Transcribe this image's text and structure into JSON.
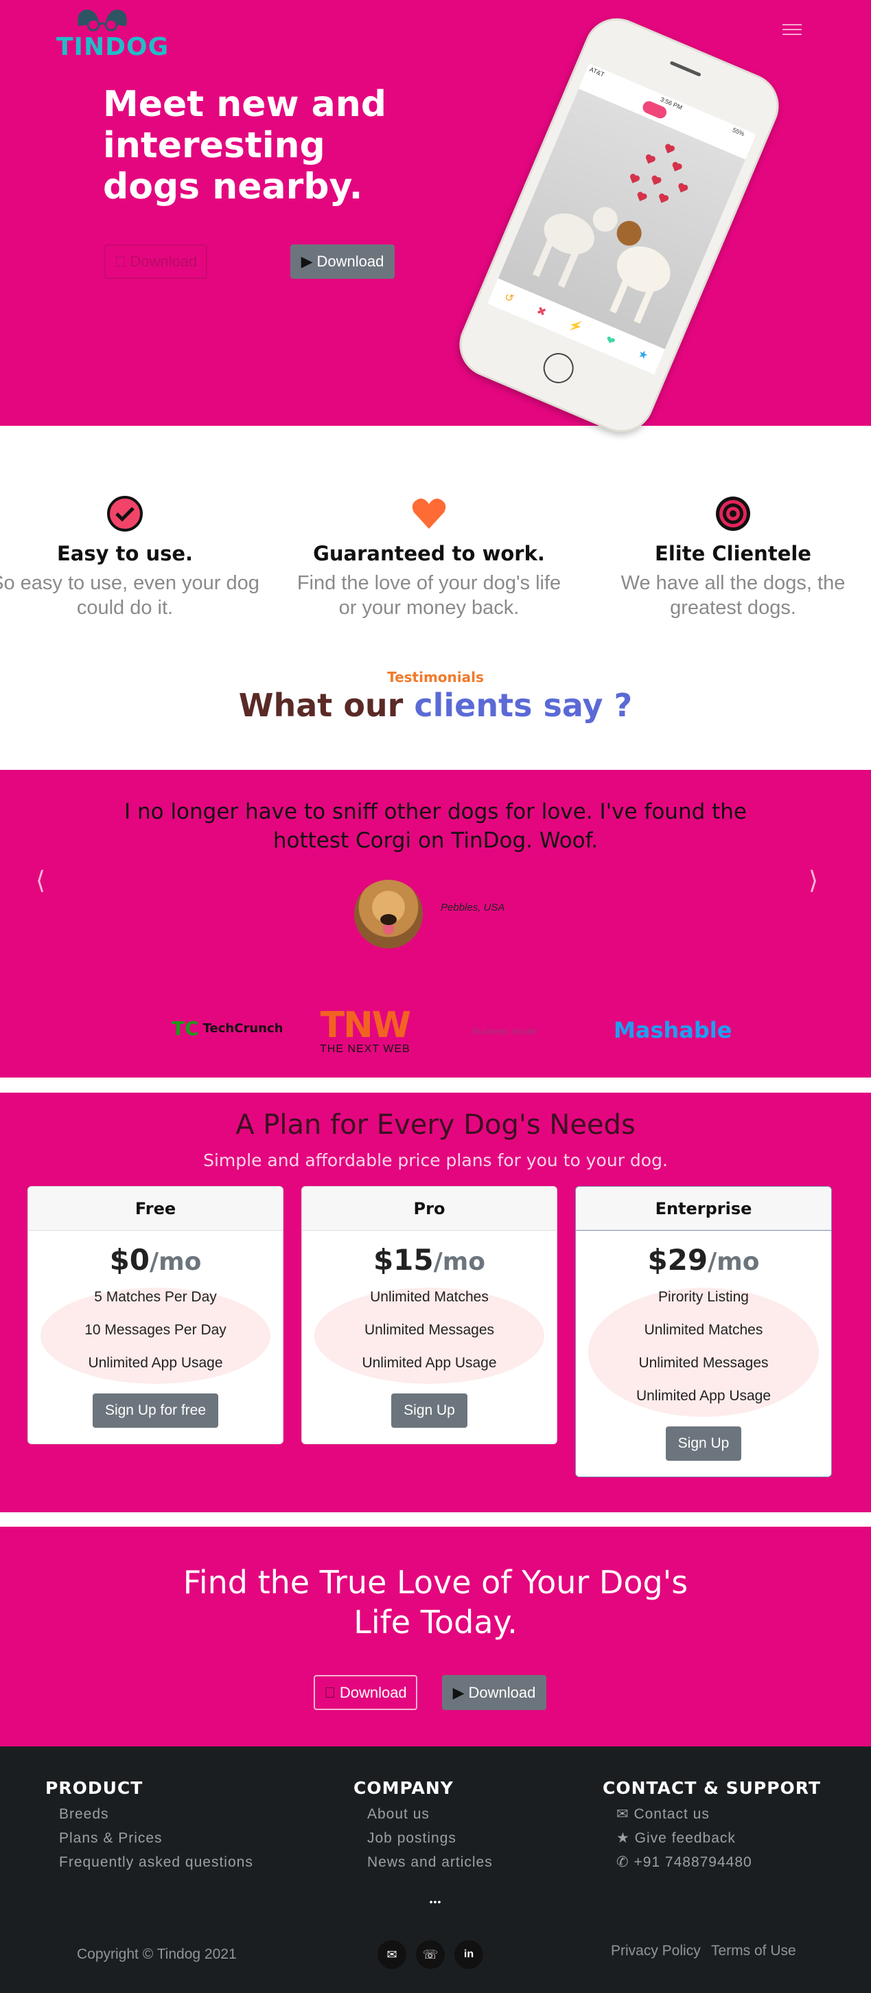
{
  "brand": {
    "name": "TINDOG"
  },
  "hero": {
    "title_line1": "Meet new and",
    "title_line2": "interesting",
    "title_line3": "dogs nearby.",
    "download_apple": "Download",
    "download_play": "Download"
  },
  "phone": {
    "carrier": "AT&T",
    "time": "3:56 PM",
    "battery": "55%"
  },
  "features": [
    {
      "icon": "check-circle-icon",
      "title": "Easy to use.",
      "text_line1": "So easy to use, even your dog",
      "text_line2": "could do it."
    },
    {
      "icon": "heart-icon",
      "title": "Guaranteed to work.",
      "text_line1": "Find the love of your dog's life",
      "text_line2": "or your money back."
    },
    {
      "icon": "bullseye-icon",
      "title": "Elite Clientele",
      "text_line1": "We have all the dogs, the",
      "text_line2": "greatest dogs."
    }
  ],
  "testimonials_header": {
    "kicker": "Testimonials",
    "title_part1": "What our",
    "title_part2": "clients say ?"
  },
  "testimonial": {
    "quote_line1": "I no longer have to sniff other dogs for love. I've found the",
    "quote_line2": "hottest Corgi on TinDog. Woof.",
    "author": "Pebbles, USA"
  },
  "press": [
    {
      "name": "TechCrunch",
      "tc": "TC"
    },
    {
      "name": "TNW",
      "sub": "THE NEXT WEB"
    },
    {
      "name": "Business Insider"
    },
    {
      "name": "Mashable"
    }
  ],
  "pricing": {
    "title": "A Plan for Every Dog's Needs",
    "subtitle": "Simple and affordable price plans for you to your dog.",
    "plans": [
      {
        "name": "Free",
        "price": "$0",
        "per": "/mo",
        "features": [
          "5 Matches Per Day",
          "10 Messages Per Day",
          "Unlimited App Usage"
        ],
        "button": "Sign Up for free"
      },
      {
        "name": "Pro",
        "price": "$15",
        "per": "/mo",
        "features": [
          "Unlimited Matches",
          "Unlimited Messages",
          "Unlimited App Usage"
        ],
        "button": "Sign Up"
      },
      {
        "name": "Enterprise",
        "price": "$29",
        "per": "/mo",
        "features": [
          "Pirority Listing",
          "Unlimited Matches",
          "Unlimited Messages",
          "Unlimited App Usage"
        ],
        "button": "Sign Up"
      }
    ]
  },
  "cta": {
    "title_line1": "Find the True Love of Your Dog's",
    "title_line2": "Life Today.",
    "download_apple": "Download",
    "download_play": "Download"
  },
  "footer": {
    "product": {
      "heading": "PRODUCT",
      "links": [
        "Breeds",
        "Plans & Prices",
        "Frequently asked questions"
      ]
    },
    "company": {
      "heading": "COMPANY",
      "links": [
        "About us",
        "Job postings",
        "News and articles"
      ]
    },
    "contact": {
      "heading": "CONTACT & SUPPORT",
      "links": [
        {
          "icon": "envelope-icon",
          "label": "Contact us"
        },
        {
          "icon": "star-icon",
          "label": "Give feedback"
        },
        {
          "icon": "phone-icon",
          "label": "+91 7488794480"
        }
      ]
    },
    "more": "•••",
    "copyright": "Copyright © Tindog 2021",
    "privacy": "Privacy Policy",
    "terms": "Terms of Use"
  },
  "colors": {
    "brand_pink": "#e4067f",
    "footer_bg": "#1b1e21",
    "button_gray": "#6c757d",
    "logo_teal": "#22bcc9"
  }
}
